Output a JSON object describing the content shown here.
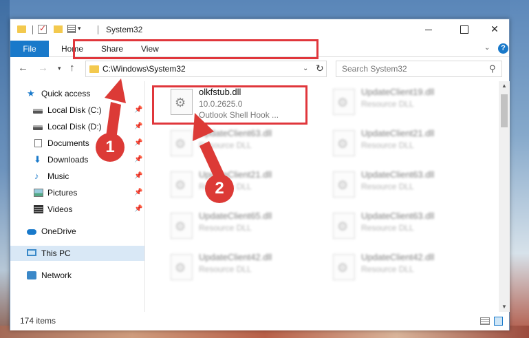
{
  "window": {
    "title": "System32"
  },
  "ribbon": {
    "tabs": [
      "File",
      "Home",
      "Share",
      "View"
    ],
    "help": "?"
  },
  "nav": {
    "address": "C:\\Windows\\System32",
    "search_placeholder": "Search System32"
  },
  "sidebar": {
    "items": [
      {
        "label": "Quick access",
        "icon": "star-icon"
      },
      {
        "label": "Local Disk (C:)",
        "icon": "disk-icon",
        "pinned": true
      },
      {
        "label": "Local Disk (D:)",
        "icon": "disk-icon",
        "pinned": true
      },
      {
        "label": "Documents",
        "icon": "documents-icon",
        "pinned": true
      },
      {
        "label": "Downloads",
        "icon": "download-icon",
        "pinned": true
      },
      {
        "label": "Music",
        "icon": "music-icon",
        "pinned": true
      },
      {
        "label": "Pictures",
        "icon": "pictures-icon",
        "pinned": true
      },
      {
        "label": "Videos",
        "icon": "videos-icon",
        "pinned": true
      },
      {
        "label": "OneDrive",
        "icon": "cloud-icon"
      },
      {
        "label": "This PC",
        "icon": "computer-icon",
        "selected": true
      },
      {
        "label": "Network",
        "icon": "network-icon"
      }
    ]
  },
  "files": [
    {
      "name": "olkfstub.dll",
      "line1": "10.0.2625.0",
      "line2": "Outlook Shell Hook ...",
      "blurred": false
    },
    {
      "name": "UpdateClient19.dll",
      "line1": "Resource DLL",
      "blurred": true
    },
    {
      "name": "UpdateClient63.dll",
      "line1": "Resource DLL",
      "blurred": true
    },
    {
      "name": "UpdateClient21.dll",
      "line1": "Resource DLL",
      "blurred": true
    },
    {
      "name": "UpdateClient21.dll",
      "line1": "Resource DLL",
      "blurred": true
    },
    {
      "name": "UpdateClient63.dll",
      "line1": "Resource DLL",
      "blurred": true
    },
    {
      "name": "UpdateClient65.dll",
      "line1": "Resource DLL",
      "blurred": true
    },
    {
      "name": "UpdateClient63.dll",
      "line1": "Resource DLL",
      "blurred": true
    },
    {
      "name": "UpdateClient42.dll",
      "line1": "Resource DLL",
      "blurred": true
    },
    {
      "name": "UpdateClient42.dll",
      "line1": "Resource DLL",
      "blurred": true
    }
  ],
  "status": {
    "item_count": "174 items"
  },
  "annotations": {
    "badge1": "1",
    "badge2": "2",
    "color": "#dc3a36"
  }
}
